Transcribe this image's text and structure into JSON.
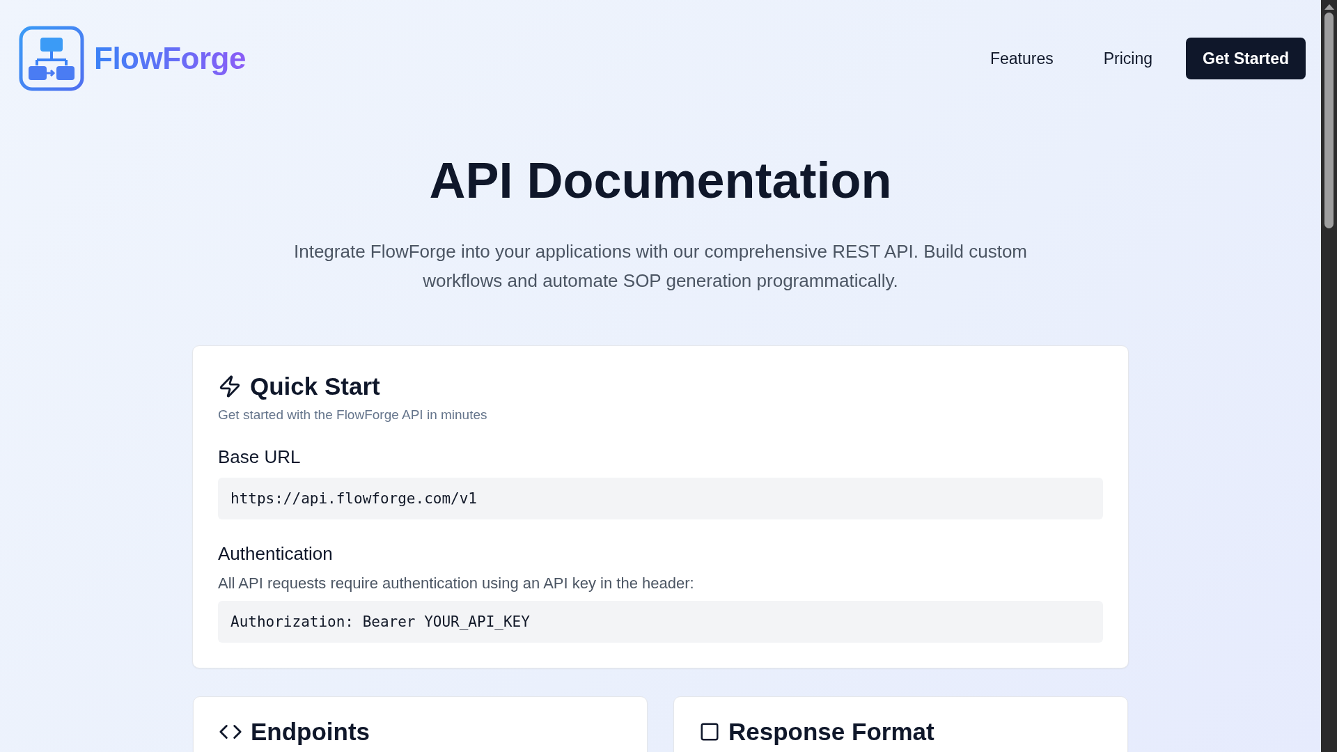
{
  "header": {
    "brand": "FlowForge",
    "nav": [
      {
        "label": "Features"
      },
      {
        "label": "Pricing"
      }
    ],
    "cta": "Get Started"
  },
  "hero": {
    "title": "API Documentation",
    "subtitle": "Integrate FlowForge into your applications with our comprehensive REST API. Build custom workflows and automate SOP generation programmatically."
  },
  "quick_start": {
    "title": "Quick Start",
    "subtitle": "Get started with the FlowForge API in minutes",
    "sections": [
      {
        "heading": "Base URL",
        "code": "https://api.flowforge.com/v1"
      },
      {
        "heading": "Authentication",
        "text": "All API requests require authentication using an API key in the header:",
        "code": "Authorization: Bearer YOUR_API_KEY"
      }
    ]
  },
  "cards": [
    {
      "kind": "code",
      "title": "Endpoints"
    },
    {
      "kind": "square",
      "title": "Response Format"
    }
  ]
}
